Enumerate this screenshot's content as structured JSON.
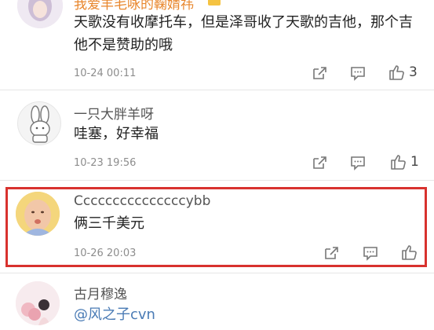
{
  "comments": [
    {
      "username": "我爱羊毛咏的鞠婧祎",
      "text": "天歌没有收摩托车，但是泽哥收了天歌的吉他，那个吉他不是赞助的哦",
      "time": "10-24 00:11",
      "likes": "3"
    },
    {
      "username": "一只大胖羊呀",
      "text": "哇塞，好幸福",
      "time": "10-23 19:56",
      "likes": "1"
    },
    {
      "username": "Cccccccccccccccybb",
      "text": "俩三千美元",
      "time": "10-26 20:03",
      "likes": ""
    },
    {
      "username": "古月穆逸",
      "text": "@风之子cvn",
      "time": "",
      "likes": ""
    }
  ],
  "icons": [
    "forward-icon",
    "comment-icon",
    "like-icon"
  ],
  "colors": {
    "highlight_border": "#d8322e",
    "mention": "#4a7bb5",
    "vip_name": "#e8862c"
  }
}
